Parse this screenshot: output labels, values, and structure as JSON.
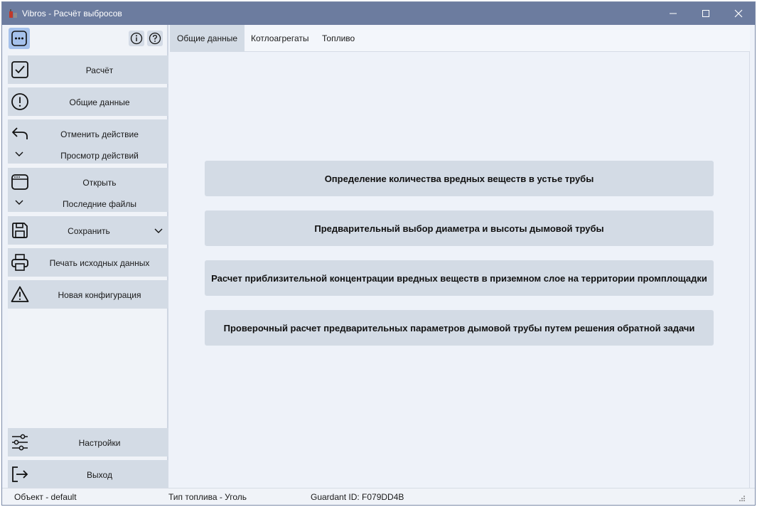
{
  "window": {
    "title": "Vibros - Расчёт выбросов"
  },
  "sidebar": {
    "items": {
      "calc": {
        "label": "Расчёт",
        "icon": "checkbox-icon"
      },
      "general": {
        "label": "Общие данные",
        "icon": "exclamation-circle-icon"
      },
      "undo": {
        "label": "Отменить действие",
        "sub_label": "Просмотр действий",
        "icon": "undo-icon"
      },
      "open": {
        "label": "Открыть",
        "sub_label": "Последние файлы",
        "icon": "window-icon"
      },
      "save": {
        "label": "Сохранить",
        "icon": "floppy-icon"
      },
      "print": {
        "label": "Печать исходных данных",
        "icon": "printer-icon"
      },
      "newconf": {
        "label": "Новая конфигурация",
        "icon": "warning-icon"
      },
      "settings": {
        "label": "Настройки",
        "icon": "sliders-icon"
      },
      "exit": {
        "label": "Выход",
        "icon": "exit-icon"
      }
    }
  },
  "tabs": {
    "general": "Общие данные",
    "boilers": "Котлоагрегаты",
    "fuel": "Топливо",
    "active": "general"
  },
  "main": {
    "actions": {
      "a1": "Определение количества вредных веществ в устье трубы",
      "a2": "Предварительный выбор диаметра и высоты дымовой трубы",
      "a3": "Расчет приблизительной концентрации вредных веществ в приземном слое на территории промплощадки",
      "a4": "Проверочный расчет предварительных параметров дымовой трубы путем решения обратной задачи"
    }
  },
  "status": {
    "object": "Объект - default",
    "fuel_type": "Тип топлива - Уголь",
    "guardant": "Guardant ID: F079DD4B"
  },
  "colors": {
    "titlebar": "#6c7c9f",
    "button": "#d3dbe5",
    "menu_accent": "#a6c2ec",
    "background": "#eef2f9"
  }
}
